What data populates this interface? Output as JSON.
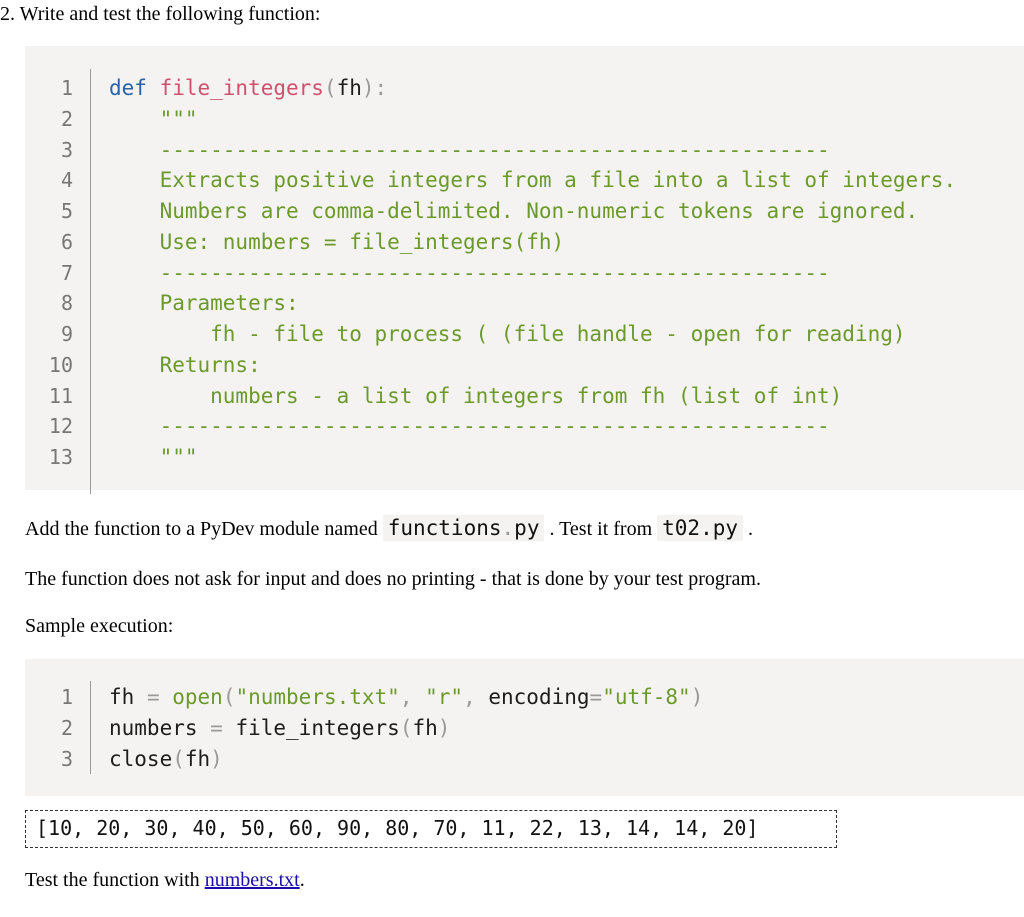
{
  "heading": "2. Write and test the following function:",
  "code1": {
    "lines": [
      {
        "n": "1",
        "segments": [
          {
            "t": "def ",
            "c": "kw"
          },
          {
            "t": "file_integers",
            "c": "fn"
          },
          {
            "t": "(",
            "c": "pn"
          },
          {
            "t": "fh",
            "c": "plain"
          },
          {
            "t": "):",
            "c": "pn"
          }
        ]
      },
      {
        "n": "2",
        "segments": [
          {
            "t": "    \"\"\"",
            "c": "doc"
          }
        ]
      },
      {
        "n": "3",
        "segments": [
          {
            "t": "    -----------------------------------------------------",
            "c": "doc"
          }
        ]
      },
      {
        "n": "4",
        "segments": [
          {
            "t": "    Extracts positive integers from a file into a list of integers.",
            "c": "doc"
          }
        ]
      },
      {
        "n": "5",
        "segments": [
          {
            "t": "    Numbers are comma-delimited. Non-numeric tokens are ignored.",
            "c": "doc"
          }
        ]
      },
      {
        "n": "6",
        "segments": [
          {
            "t": "    Use: numbers = file_integers(fh)",
            "c": "doc"
          }
        ]
      },
      {
        "n": "7",
        "segments": [
          {
            "t": "    -----------------------------------------------------",
            "c": "doc"
          }
        ]
      },
      {
        "n": "8",
        "segments": [
          {
            "t": "    Parameters:",
            "c": "doc"
          }
        ]
      },
      {
        "n": "9",
        "segments": [
          {
            "t": "        fh - file to process ( (file handle - open for reading)",
            "c": "doc"
          }
        ]
      },
      {
        "n": "10",
        "segments": [
          {
            "t": "    Returns:",
            "c": "doc"
          }
        ]
      },
      {
        "n": "11",
        "segments": [
          {
            "t": "        numbers - a list of integers from fh (list of int)",
            "c": "doc"
          }
        ]
      },
      {
        "n": "12",
        "segments": [
          {
            "t": "    -----------------------------------------------------",
            "c": "doc"
          }
        ]
      },
      {
        "n": "13",
        "segments": [
          {
            "t": "    \"\"\"",
            "c": "doc"
          }
        ]
      }
    ]
  },
  "para_add": {
    "before": "Add the function to a PyDev module named ",
    "module_name": "functions",
    "module_dot": ".",
    "module_ext": "py",
    "middle": " . Test it from ",
    "test_file": "t02.py",
    "after": " ."
  },
  "para_desc": "The function does not ask for input and does no printing - that is done by your test program.",
  "para_sample": "Sample execution:",
  "code2": {
    "lines": [
      {
        "n": "1",
        "segments": [
          {
            "t": "fh ",
            "c": "plain"
          },
          {
            "t": "=",
            "c": "op"
          },
          {
            "t": " open",
            "c": "str"
          },
          {
            "t": "(",
            "c": "pn"
          },
          {
            "t": "\"numbers.txt\"",
            "c": "str"
          },
          {
            "t": ", ",
            "c": "pn"
          },
          {
            "t": "\"r\"",
            "c": "str"
          },
          {
            "t": ", ",
            "c": "pn"
          },
          {
            "t": "encoding",
            "c": "plain"
          },
          {
            "t": "=",
            "c": "op"
          },
          {
            "t": "\"utf-8\"",
            "c": "str"
          },
          {
            "t": ")",
            "c": "pn"
          }
        ]
      },
      {
        "n": "2",
        "segments": [
          {
            "t": "numbers ",
            "c": "plain"
          },
          {
            "t": "=",
            "c": "op"
          },
          {
            "t": " file_integers",
            "c": "plain"
          },
          {
            "t": "(",
            "c": "pn"
          },
          {
            "t": "fh",
            "c": "plain"
          },
          {
            "t": ")",
            "c": "pn"
          }
        ]
      },
      {
        "n": "3",
        "segments": [
          {
            "t": "close",
            "c": "plain"
          },
          {
            "t": "(",
            "c": "pn"
          },
          {
            "t": "fh",
            "c": "plain"
          },
          {
            "t": ")",
            "c": "pn"
          }
        ]
      }
    ]
  },
  "output": "[10, 20, 30, 40, 50, 60, 90, 80, 70, 11, 22, 13, 14, 14, 20]",
  "para_test": {
    "before": "Test the function with ",
    "link": "numbers.txt",
    "after": "."
  }
}
